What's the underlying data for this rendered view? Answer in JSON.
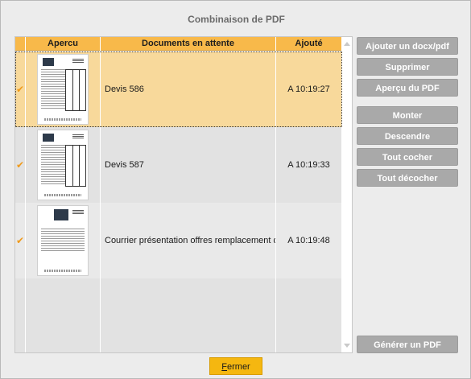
{
  "window": {
    "title": "Combinaison de PDF"
  },
  "table": {
    "columns": [
      "",
      "Apercu",
      "Documents en attente",
      "Ajouté"
    ],
    "rows": [
      {
        "checked": true,
        "check_icon": "checkmark-icon",
        "thumbnail": "quote-document",
        "document": "Devis 586",
        "added": "A 10:19:27",
        "selected": true
      },
      {
        "checked": true,
        "check_icon": "checkmark-icon",
        "thumbnail": "quote-document",
        "document": "Devis 587",
        "added": "A 10:19:33",
        "selected": false
      },
      {
        "checked": true,
        "check_icon": "checkmark-icon",
        "thumbnail": "letter-document",
        "document": "Courrier présentation offres remplacement de votre chau",
        "added": "A 10:19:48",
        "selected": false
      }
    ],
    "check_glyph": "✔"
  },
  "buttons": {
    "add": "Ajouter un docx/pdf",
    "delete": "Supprimer",
    "preview": "Aperçu du PDF",
    "up": "Monter",
    "down": "Descendre",
    "check_all": "Tout cocher",
    "uncheck_all": "Tout décocher",
    "generate": "Générer un PDF"
  },
  "footer": {
    "close_prefix": "",
    "close_underlined": "F",
    "close_rest": "ermer"
  },
  "colors": {
    "header": "#f8b94a",
    "selected_row": "#f8d99b",
    "button": "#a9a9a9",
    "close_button": "#f5b710",
    "check": "#f09a1a"
  }
}
